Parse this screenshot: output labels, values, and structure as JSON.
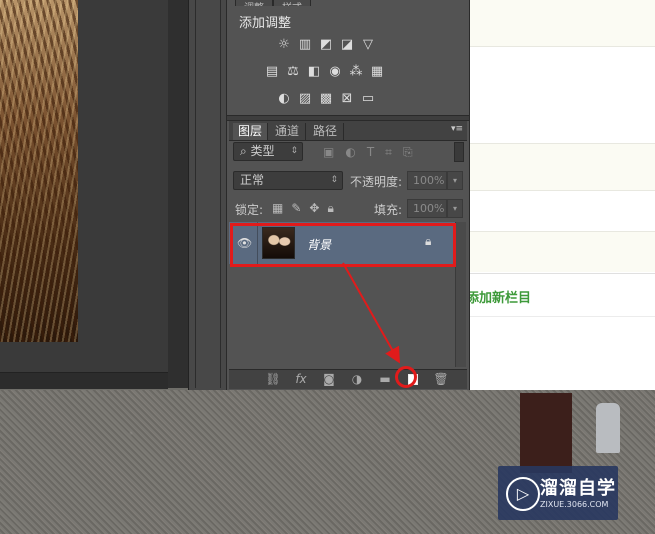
{
  "adjustments_panel": {
    "tabs": [
      "调整",
      "样式"
    ],
    "title": "添加调整",
    "row1_icons": [
      "brightness-contrast-icon",
      "levels-icon",
      "curves-icon",
      "exposure-icon",
      "vibrance-icon"
    ],
    "row2_icons": [
      "hue-saturation-icon",
      "color-balance-icon",
      "black-white-icon",
      "photo-filter-icon",
      "channel-mixer-icon",
      "color-lookup-icon"
    ],
    "row3_icons": [
      "invert-icon",
      "posterize-icon",
      "threshold-icon",
      "selective-color-icon",
      "gradient-map-icon"
    ]
  },
  "layers_panel": {
    "tabs": [
      {
        "label": "图层",
        "active": true
      },
      {
        "label": "通道",
        "active": false
      },
      {
        "label": "路径",
        "active": false
      }
    ],
    "filter_kind": "类型",
    "blend_mode": "正常",
    "opacity_label": "不透明度:",
    "opacity_value": "100%",
    "lock_label": "锁定:",
    "fill_label": "填充:",
    "fill_value": "100%",
    "layers": [
      {
        "name": "背景",
        "visible": true,
        "locked": true,
        "selected": true
      }
    ],
    "bottom_icons": [
      "link-layers-icon",
      "fx-icon",
      "add-mask-icon",
      "adjustment-layer-icon",
      "group-folder-icon",
      "new-layer-icon",
      "trash-icon"
    ]
  },
  "webpage": {
    "link_text": "添加新栏目"
  },
  "watermark": {
    "title": "溜溜自学",
    "subtitle": "ZIXUE.3066.COM"
  },
  "annotation_color": "#e11b1b"
}
